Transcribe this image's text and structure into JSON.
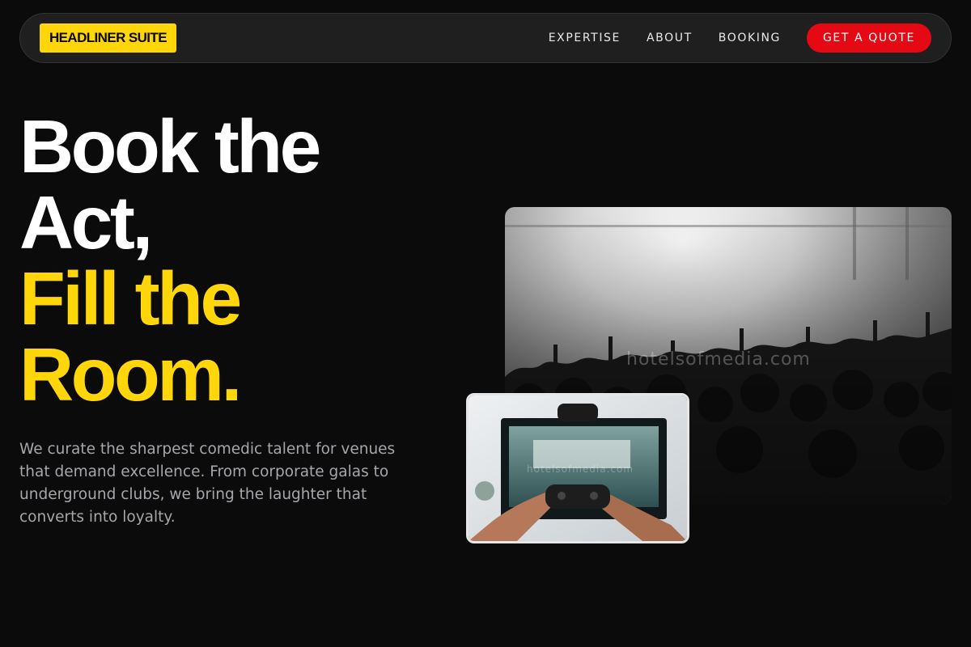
{
  "nav": {
    "brand": "HEADLINER SUITE",
    "links": [
      "EXPERTISE",
      "ABOUT",
      "BOOKING"
    ],
    "cta": "GET A QUOTE"
  },
  "hero": {
    "headline_white": [
      "Book the",
      "Act,"
    ],
    "headline_yellow": [
      "Fill the",
      "Room."
    ],
    "lead": "We curate the sharpest comedic talent for venues that demand excellence. From corporate galas to underground clubs, we bring the laughter that converts into loyalty."
  },
  "images": {
    "main_watermark": "hotelsofmedia.com",
    "small_watermark": "hotelsofmedia.com"
  },
  "colors": {
    "background": "#0b0b0c",
    "accent_yellow": "#ffd60a",
    "cta_red": "#e50914"
  }
}
